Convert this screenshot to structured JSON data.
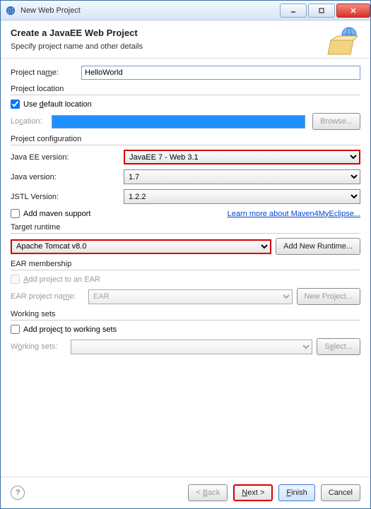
{
  "window": {
    "title": "New Web Project"
  },
  "header": {
    "title": "Create a JavaEE Web Project",
    "subtitle": "Specify project name and other details"
  },
  "project_name": {
    "label": "Project name:",
    "value": "HelloWorld"
  },
  "location": {
    "legend": "Project location",
    "use_default": "Use default location",
    "use_default_checked": true,
    "location_label": "Location:",
    "browse": "Browse..."
  },
  "config": {
    "legend": "Project configuration",
    "jee_label": "Java EE version:",
    "jee_value": "JavaEE 7 - Web 3.1",
    "java_label": "Java version:",
    "java_value": "1.7",
    "jstl_label": "JSTL Version:",
    "jstl_value": "1.2.2",
    "maven_label": "Add maven support",
    "maven_link": "Learn more about Maven4MyEclipse..."
  },
  "runtime": {
    "legend": "Target runtime",
    "value": "Apache Tomcat v8.0",
    "add": "Add New Runtime..."
  },
  "ear": {
    "legend": "EAR membership",
    "add_label": "Add project to an EAR",
    "project_label": "EAR project name:",
    "project_value": "EAR",
    "new": "New Project..."
  },
  "ws": {
    "legend": "Working sets",
    "add_label": "Add project to working sets",
    "label": "Working sets:",
    "select": "Select..."
  },
  "footer": {
    "back": "< Back",
    "next": "Next >",
    "finish": "Finish",
    "cancel": "Cancel"
  }
}
